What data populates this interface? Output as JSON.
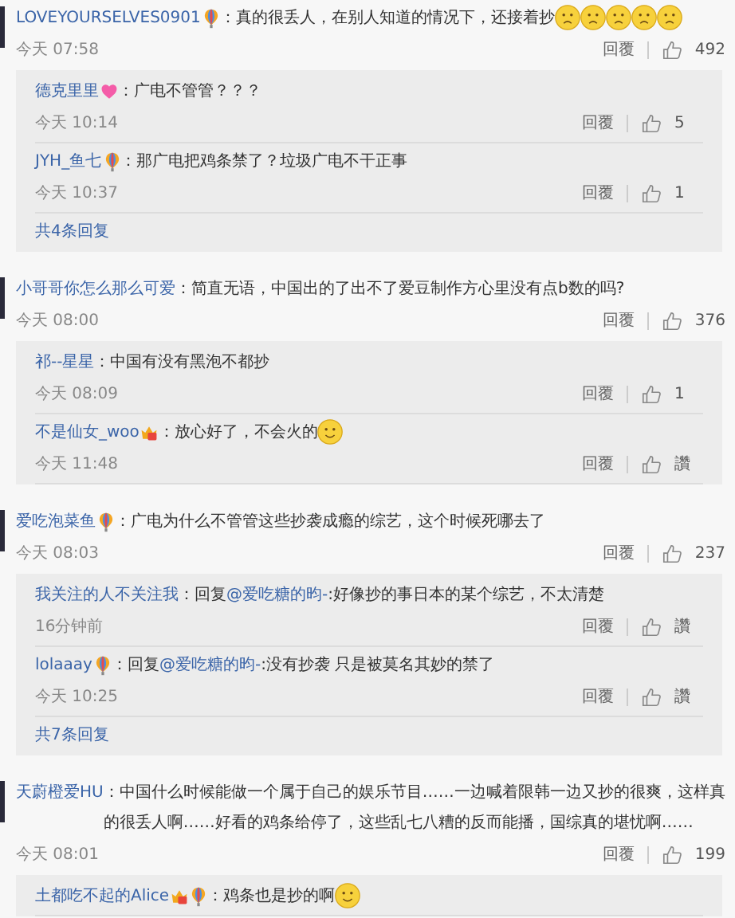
{
  "threads": [
    {
      "user": "LOVEYOURSELVES0901",
      "badges": [
        {
          "kind": "balloon"
        }
      ],
      "text": "：真的很丢人，在别人知道的情况下，还接着抄",
      "emojis": [
        {
          "kind": "sad"
        },
        {
          "kind": "sad"
        },
        {
          "kind": "sad"
        },
        {
          "kind": "sad"
        },
        {
          "kind": "sad"
        }
      ],
      "time": "今天 07:58",
      "reply_label": "回覆",
      "likes": "492",
      "replies": [
        {
          "user": "德克里里",
          "badges": [
            {
              "kind": "heart"
            }
          ],
          "text": "：广电不管管？？？",
          "time": "今天 10:14",
          "reply_label": "回覆",
          "likes": "5"
        },
        {
          "user": "JYH_鱼七",
          "badges": [
            {
              "kind": "balloon"
            }
          ],
          "text": "：那广电把鸡条禁了？垃圾广电不干正事",
          "time": "今天 10:37",
          "reply_label": "回覆",
          "likes": "1"
        }
      ],
      "more": "共4条回复"
    },
    {
      "user": "小哥哥你怎么那么可爱",
      "text": "：简直无语，中国出的了出不了爱豆制作方心里没有点b数的吗?",
      "time": "今天 08:00",
      "reply_label": "回覆",
      "likes": "376",
      "replies": [
        {
          "user": "祁--星星",
          "text": "：中国有没有黑泡不都抄",
          "time": "今天 08:09",
          "reply_label": "回覆",
          "likes": "1"
        },
        {
          "user": "不是仙女_woo",
          "badges": [
            {
              "kind": "crown"
            }
          ],
          "text": "：放心好了，不会火的",
          "emojis": [
            {
              "kind": "smile"
            }
          ],
          "time": "今天 11:48",
          "reply_label": "回覆",
          "likes": "讚"
        }
      ]
    },
    {
      "user": "爱吃泡菜鱼",
      "badges": [
        {
          "kind": "balloon"
        }
      ],
      "text": "：广电为什么不管管这些抄袭成瘾的综艺，这个时候死哪去了",
      "time": "今天 08:03",
      "reply_label": "回覆",
      "likes": "237",
      "replies": [
        {
          "user": "我关注的人不关注我",
          "prefix": "：回复",
          "mention": "@爱吃糖的昀-",
          "text": ":好像抄的事日本的某个综艺，不太清楚",
          "time": "16分钟前",
          "reply_label": "回覆",
          "likes": "讚"
        },
        {
          "user": "lolaaay",
          "badges": [
            {
              "kind": "balloon"
            }
          ],
          "prefix": "：回复",
          "mention": "@爱吃糖的昀-",
          "text": ":没有抄袭 只是被莫名其妙的禁了",
          "time": "今天 10:25",
          "reply_label": "回覆",
          "likes": "讚"
        }
      ],
      "more": "共7条回复"
    },
    {
      "user": "天蔚橙爱HU",
      "text": "：中国什么时候能做一个属于自己的娱乐节目……一边喊着限韩一边又抄的很爽，这样真的很丢人啊……好看的鸡条给停了，这些乱七八糟的反而能播，国综真的堪忧啊……",
      "time": "今天 08:01",
      "reply_label": "回覆",
      "likes": "199",
      "replies": [
        {
          "user": "土都吃不起的Alice",
          "badges": [
            {
              "kind": "crown"
            },
            {
              "kind": "balloon"
            }
          ],
          "text": "：鸡条也是抄的啊",
          "emojis": [
            {
              "kind": "smile"
            }
          ]
        }
      ]
    }
  ]
}
